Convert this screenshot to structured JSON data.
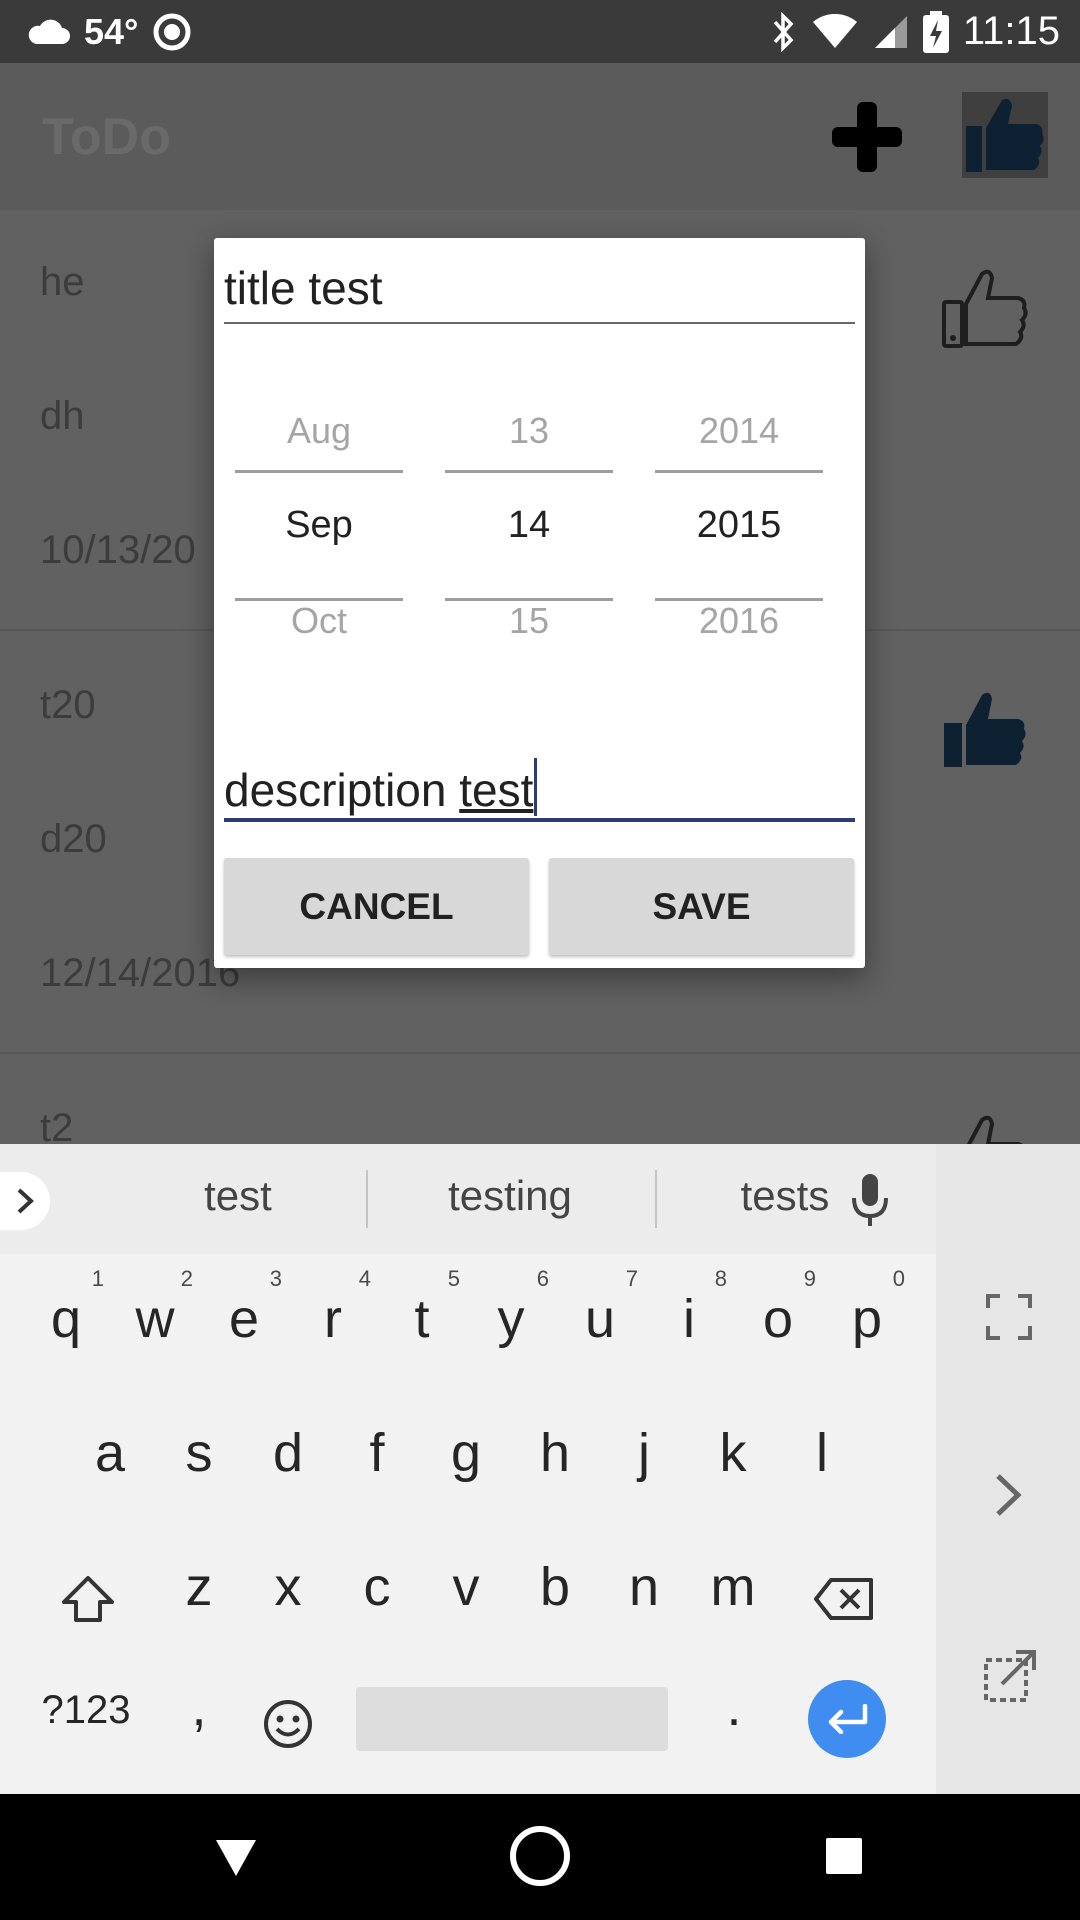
{
  "status_bar": {
    "temperature": "54°",
    "time": "11:15",
    "icons": [
      "cloud-icon",
      "record-icon",
      "bluetooth-icon",
      "wifi-icon",
      "signal-icon",
      "battery-charging-icon"
    ]
  },
  "app_bar": {
    "title": "ToDo",
    "add_icon": "plus-icon",
    "like_icon": "thumbs-up-icon"
  },
  "list": {
    "items": [
      {
        "title": "he",
        "description": "dh",
        "date": "10/13/20",
        "liked": false
      },
      {
        "title": "t20",
        "description": "d20",
        "date": "12/14/2016",
        "liked": true
      },
      {
        "title": "t2",
        "description": "",
        "date": "",
        "liked": false
      }
    ]
  },
  "dialog": {
    "title_value": "title test",
    "date_picker": {
      "month": {
        "prev": "Aug",
        "current": "Sep",
        "next": "Oct"
      },
      "day": {
        "prev": "13",
        "current": "14",
        "next": "15"
      },
      "year": {
        "prev": "2014",
        "current": "2015",
        "next": "2016"
      }
    },
    "description_prefix": "description ",
    "description_word": "test",
    "cancel_label": "CANCEL",
    "save_label": "SAVE"
  },
  "keyboard": {
    "suggestions": [
      "test",
      "testing",
      "tests"
    ],
    "row1": [
      {
        "k": "q",
        "n": "1"
      },
      {
        "k": "w",
        "n": "2"
      },
      {
        "k": "e",
        "n": "3"
      },
      {
        "k": "r",
        "n": "4"
      },
      {
        "k": "t",
        "n": "5"
      },
      {
        "k": "y",
        "n": "6"
      },
      {
        "k": "u",
        "n": "7"
      },
      {
        "k": "i",
        "n": "8"
      },
      {
        "k": "o",
        "n": "9"
      },
      {
        "k": "p",
        "n": "0"
      }
    ],
    "row2": [
      "a",
      "s",
      "d",
      "f",
      "g",
      "h",
      "j",
      "k",
      "l"
    ],
    "row3": [
      "z",
      "x",
      "c",
      "v",
      "b",
      "n",
      "m"
    ],
    "symbols_label": "?123",
    "comma_label": ",",
    "period_label": ".",
    "accent_color": "#3f8df0"
  },
  "nav_bar": {
    "icons": [
      "back-icon",
      "home-icon",
      "recents-icon"
    ]
  }
}
